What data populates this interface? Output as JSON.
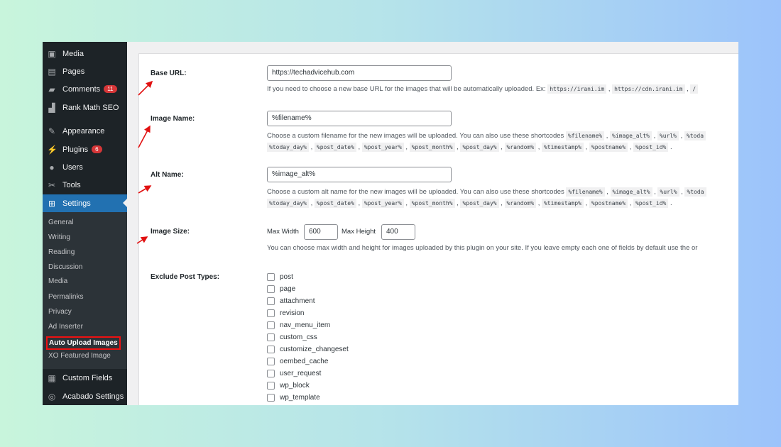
{
  "sidebar": {
    "items": [
      {
        "label": "Media",
        "icon": "media-icon"
      },
      {
        "label": "Pages",
        "icon": "pages-icon"
      },
      {
        "label": "Comments",
        "icon": "comments-icon",
        "badge": "11"
      },
      {
        "label": "Rank Math SEO",
        "icon": "rank-math-icon"
      },
      {
        "label": "Appearance",
        "icon": "brush-icon"
      },
      {
        "label": "Plugins",
        "icon": "plugin-icon",
        "badge": "6"
      },
      {
        "label": "Users",
        "icon": "user-icon"
      },
      {
        "label": "Tools",
        "icon": "wrench-icon"
      },
      {
        "label": "Settings",
        "icon": "settings-icon"
      },
      {
        "label": "Custom Fields",
        "icon": "table-icon"
      },
      {
        "label": "Acabado Settings",
        "icon": "acabado-icon"
      }
    ],
    "submenu": [
      "General",
      "Writing",
      "Reading",
      "Discussion",
      "Media",
      "Permalinks",
      "Privacy",
      "Ad Inserter",
      "Auto Upload Images",
      "XO Featured Image"
    ]
  },
  "form": {
    "base_url": {
      "label": "Base URL:",
      "value": "https://techadvicehub.com",
      "desc": "If you need to choose a new base URL for the images that will be automatically uploaded. Ex:",
      "codes": [
        "https://irani.im",
        "https://cdn.irani.im",
        "/"
      ]
    },
    "image_name": {
      "label": "Image Name:",
      "value": "%filename%",
      "desc": "Choose a custom filename for the new images will be uploaded. You can also use these shortcodes"
    },
    "alt_name": {
      "label": "Alt Name:",
      "value": "%image_alt%",
      "desc": "Choose a custom alt name for the new images will be uploaded. You can also use these shortcodes"
    },
    "shortcodes_line1": [
      "%filename%",
      "%image_alt%",
      "%url%",
      "%toda"
    ],
    "shortcodes_line2": [
      "%today_day%",
      "%post_date%",
      "%post_year%",
      "%post_month%",
      "%post_day%",
      "%random%",
      "%timestamp%",
      "%postname%",
      "%post_id%"
    ],
    "image_size": {
      "label": "Image Size:",
      "max_width_label": "Max Width",
      "max_width": "600",
      "max_height_label": "Max Height",
      "max_height": "400",
      "desc": "You can choose max width and height for images uploaded by this plugin on your site. If you leave empty each one of fields by default use the or"
    },
    "exclude": {
      "label": "Exclude Post Types:",
      "types": [
        "post",
        "page",
        "attachment",
        "revision",
        "nav_menu_item",
        "custom_css",
        "customize_changeset",
        "oembed_cache",
        "user_request",
        "wp_block",
        "wp_template"
      ]
    }
  },
  "colors": {
    "sidebar": "#1d2327",
    "active": "#2271b1",
    "annotation": "#e11111"
  }
}
